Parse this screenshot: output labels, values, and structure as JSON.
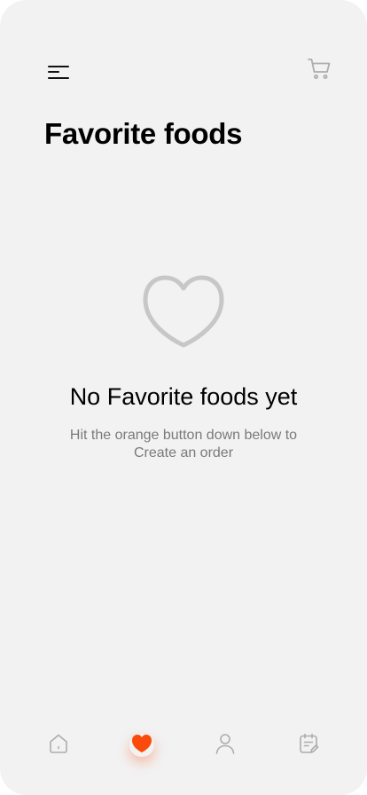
{
  "header": {
    "menu_icon": "menu-icon",
    "cart_icon": "cart-icon"
  },
  "page": {
    "title": "Favorite foods"
  },
  "empty_state": {
    "icon": "heart-outline-icon",
    "title": "No Favorite foods yet",
    "subtitle": "Hit the orange button down below to Create an order"
  },
  "bottom_nav": {
    "items": [
      {
        "icon": "home-icon",
        "active": false
      },
      {
        "icon": "heart-icon",
        "active": true
      },
      {
        "icon": "user-icon",
        "active": false
      },
      {
        "icon": "history-icon",
        "active": false
      }
    ]
  },
  "colors": {
    "accent": "#fa4a0c",
    "background": "#f2f2f2",
    "icon_inactive": "#adadad",
    "empty_icon": "#c7c7c7",
    "title_text": "#000000",
    "muted_text": "#7a7a7a"
  }
}
